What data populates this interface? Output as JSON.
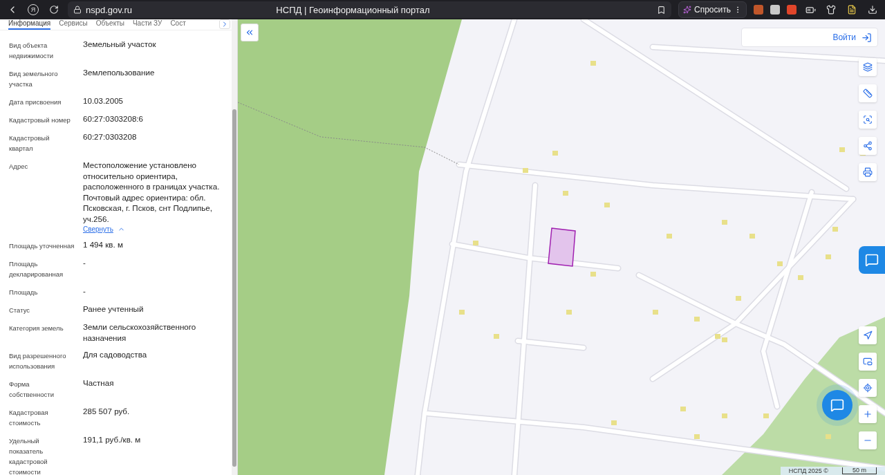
{
  "browser": {
    "home_glyph": "Я",
    "url": "nspd.gov.ru",
    "title": "НСПД | Геоинформационный портал",
    "ask_button": "Спросить"
  },
  "panel": {
    "tabs": [
      {
        "label": "Информация",
        "selected": true
      },
      {
        "label": "Сервисы",
        "selected": false
      },
      {
        "label": "Объекты",
        "selected": false
      },
      {
        "label": "Части ЗУ",
        "selected": false
      },
      {
        "label": "Сост",
        "selected": false
      }
    ],
    "rows": [
      {
        "label": "Вид объекта недвижимости",
        "value": "Земельный участок"
      },
      {
        "label": "Вид земельного участка",
        "value": "Землепользование"
      },
      {
        "label": "Дата присвоения",
        "value": "10.03.2005"
      },
      {
        "label": "Кадастровый номер",
        "value": "60:27:0303208:6"
      },
      {
        "label": "Кадастровый квартал",
        "value": "60:27:0303208"
      },
      {
        "label": "Адрес",
        "value": "Местоположение установлено относительно ориентира, расположенного в границах участка. Почтовый адрес ориентира: обл. Псковская, г. Псков, снт Подлипье, уч.256.",
        "toggle": {
          "label": "Свернуть",
          "expanded": true
        }
      },
      {
        "label": "Площадь уточненная",
        "value": "1 494 кв. м"
      },
      {
        "label": "Площадь декларированная",
        "value": "-"
      },
      {
        "label": "Площадь",
        "value": "-"
      },
      {
        "label": "Статус",
        "value": "Ранее учтенный"
      },
      {
        "label": "Категория земель",
        "value": "Земли сельскохозяйственного назначения"
      },
      {
        "label": "Вид разрешенного использования",
        "value": "Для садоводства"
      },
      {
        "label": "Форма собственности",
        "value": "Частная"
      },
      {
        "label": "Кадастровая стоимость",
        "value": "285 507 руб."
      },
      {
        "label": "Удельный показатель кадастровой стоимости",
        "value": "191,1 руб./кв. м"
      }
    ]
  },
  "map": {
    "login": "Войти",
    "attribution": "НСПД 2025 ©",
    "scale": "50 m"
  }
}
